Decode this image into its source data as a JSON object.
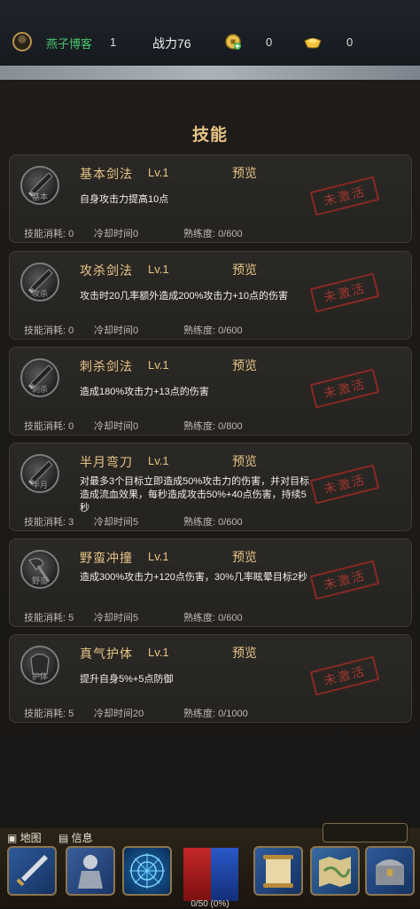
{
  "header": {
    "player_name": "燕子博客",
    "level": "1",
    "power": "战力76",
    "coins": "0",
    "ingots": "0"
  },
  "page_title": "技能",
  "skills": [
    {
      "name": "基本剑法",
      "level": "Lv.1",
      "preview": "预览",
      "desc": "自身攻击力提高10点",
      "cost": "技能消耗: 0",
      "cooldown": "冷却时间0",
      "proficiency": "熟练度: 0/600",
      "status": "未激活",
      "icon_caption": "基本"
    },
    {
      "name": "攻杀剑法",
      "level": "Lv.1",
      "preview": "预览",
      "desc": "攻击时20几率额外造成200%攻击力+10点的伤害",
      "cost": "技能消耗: 0",
      "cooldown": "冷却时间0",
      "proficiency": "熟练度: 0/600",
      "status": "未激活",
      "icon_caption": "攻杀"
    },
    {
      "name": "刺杀剑法",
      "level": "Lv.1",
      "preview": "预览",
      "desc": "造成180%攻击力+13点的伤害",
      "cost": "技能消耗: 0",
      "cooldown": "冷却时间0",
      "proficiency": "熟练度: 0/800",
      "status": "未激活",
      "icon_caption": "刺杀"
    },
    {
      "name": "半月弯刀",
      "level": "Lv.1",
      "preview": "预览",
      "desc": "对最多3个目标立即造成50%攻击力的伤害，并对目标造成流血效果，每秒造成攻击50%+40点伤害，持续5秒",
      "cost": "技能消耗: 3",
      "cooldown": "冷却时间5",
      "proficiency": "熟练度: 0/600",
      "status": "未激活",
      "icon_caption": "半月"
    },
    {
      "name": "野蛮冲撞",
      "level": "Lv.1",
      "preview": "预览",
      "desc": "造成300%攻击力+120点伤害，30%几率眩晕目标2秒",
      "cost": "技能消耗: 5",
      "cooldown": "冷却时间5",
      "proficiency": "熟练度: 0/600",
      "status": "未激活",
      "icon_caption": "野蛮"
    },
    {
      "name": "真气护体",
      "level": "Lv.1",
      "preview": "预览",
      "desc": "提升自身5%+5点防御",
      "cost": "技能消耗: 5",
      "cooldown": "冷却时间20",
      "proficiency": "熟练度: 0/1000",
      "status": "未激活",
      "icon_caption": "护体"
    }
  ],
  "bottom": {
    "map_label": "地图",
    "info_label": "信息",
    "exp_text": "0/50 (0%)"
  },
  "icons": [
    "avatar",
    "coin-icon",
    "ingot-icon",
    "sword-icon",
    "armor-icon",
    "web-icon",
    "scroll-icon",
    "map-icon",
    "chest-icon"
  ],
  "colors": {
    "accent_gold": "#e8c486",
    "stamp_red": "#b83a33",
    "name_green": "#49c36a"
  }
}
